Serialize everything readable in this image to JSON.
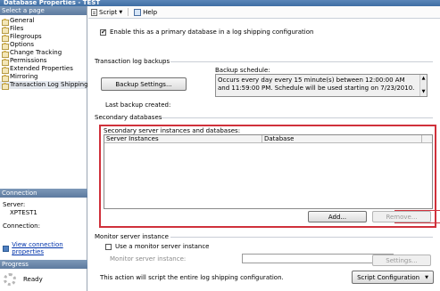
{
  "window": {
    "title": "Database Properties - TEST"
  },
  "sidebar": {
    "header": "Select a page",
    "items": [
      {
        "label": "General",
        "selected": false
      },
      {
        "label": "Files",
        "selected": false
      },
      {
        "label": "Filegroups",
        "selected": false
      },
      {
        "label": "Options",
        "selected": false
      },
      {
        "label": "Change Tracking",
        "selected": false
      },
      {
        "label": "Permissions",
        "selected": false
      },
      {
        "label": "Extended Properties",
        "selected": false
      },
      {
        "label": "Mirroring",
        "selected": false
      },
      {
        "label": "Transaction Log Shipping",
        "selected": true
      }
    ],
    "connection_header": "Connection",
    "server_label": "Server:",
    "server_value": "XPTEST1",
    "connection_label": "Connection:",
    "connection_value": "",
    "view_connection_properties": "View connection properties",
    "progress_header": "Progress",
    "progress_status": "Ready"
  },
  "toolbar": {
    "script_label": "Script",
    "help_label": "Help"
  },
  "primary": {
    "enable_label": "Enable this as a primary database in a log shipping configuration",
    "enable_checked": true
  },
  "backups": {
    "section_label": "Transaction log backups",
    "backup_settings_button": "Backup Settings...",
    "schedule_label": "Backup schedule:",
    "schedule_text": "Occurs every day every 15 minute(s) between 12:00:00 AM and 11:59:00 PM. Schedule will be used starting on 7/23/2010.",
    "last_backup_label": "Last backup created:",
    "last_backup_value": ""
  },
  "secondary": {
    "section_label": "Secondary databases",
    "grid_label": "Secondary server instances and databases:",
    "columns": [
      "Server Instances",
      "Database"
    ],
    "rows": [],
    "add_button": "Add...",
    "remove_button": "Remove..."
  },
  "monitor": {
    "section_label": "Monitor server instance",
    "use_monitor_label": "Use a monitor server instance",
    "use_monitor_checked": false,
    "monitor_field_label": "Monitor server instance:",
    "monitor_field_value": "",
    "settings_button": "Settings..."
  },
  "footer": {
    "note": "This action will script the entire log shipping configuration.",
    "script_config_button": "Script Configuration"
  },
  "colors": {
    "highlight_red": "#d0313b",
    "header_blue": "#5d7a9f"
  }
}
